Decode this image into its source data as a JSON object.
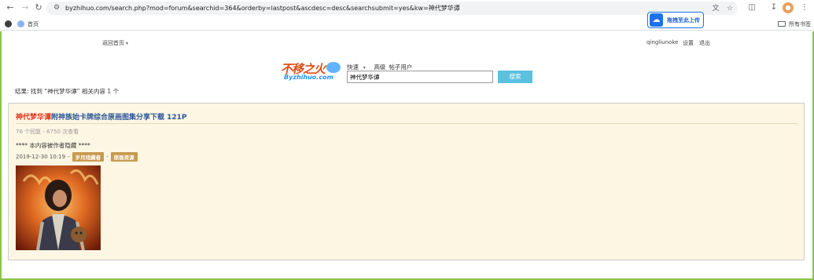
{
  "browser": {
    "url": "byzhihuo.com/search.php?mod=forum&searchid=364&orderby=lastpost&ascdesc=desc&searchsubmit=yes&kw=神代梦华谭",
    "bookmarks": {
      "home": "首页",
      "all_bookmarks": "所有书签"
    },
    "extension_upload_label": "拖拽至此上传"
  },
  "site": {
    "nav_home": "返回首页",
    "username": "qingliunoke",
    "settings": "设置",
    "logout": "退出",
    "logo_text_top": "不移之火",
    "logo_text_bottom": "Byzhihuo.com"
  },
  "search": {
    "tabs": [
      "快速",
      "高级",
      "帖子",
      "用户"
    ],
    "query": "神代梦华谭",
    "button_label": "搜索",
    "summary": "结果: 找到 “神代梦华谭” 相关内容 1 个"
  },
  "result": {
    "title_highlight": "神代梦华谭",
    "title_rest": "附神族始卡牌综合原画图集分享下载 121P",
    "meta": "76 个回复 - 6750 次查看",
    "hidden_note": "**** 本内容被作者隐藏 ****",
    "date": "2019-12-30 10:19",
    "sep": "-",
    "tags": [
      "岁月戏藏者",
      "原画资源"
    ]
  },
  "colors": {
    "accent_green": "#8bc34a",
    "search_button": "#5bc0de",
    "highlight_red": "#e0331a",
    "title_blue": "#2b5797",
    "result_bg": "#fdf6e3",
    "tag_bg": "#c89a4e"
  }
}
